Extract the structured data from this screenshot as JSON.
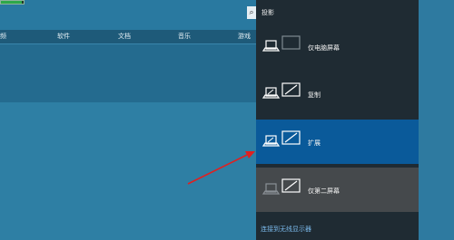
{
  "app": {
    "progress_level": 0.9,
    "search_icon": "search-icon",
    "categories": [
      "频",
      "软件",
      "文档",
      "音乐",
      "游戏"
    ]
  },
  "project_panel": {
    "title": "投影",
    "options": [
      {
        "label": "仅电脑屏幕",
        "icon": "pc-screen-only-icon",
        "state": "normal"
      },
      {
        "label": "复制",
        "icon": "duplicate-icon",
        "state": "normal"
      },
      {
        "label": "扩展",
        "icon": "extend-icon",
        "state": "selected"
      },
      {
        "label": "仅第二屏幕",
        "icon": "second-screen-only-icon",
        "state": "hover"
      }
    ],
    "connect_link": "连接到无线显示器"
  },
  "annotation": {
    "arrow_color": "#e02020"
  },
  "colors": {
    "panel_bg": "#1f2b33",
    "selected_bg": "#0a5a9a",
    "hover_bg": "#45494c",
    "link": "#7ab8ea"
  }
}
